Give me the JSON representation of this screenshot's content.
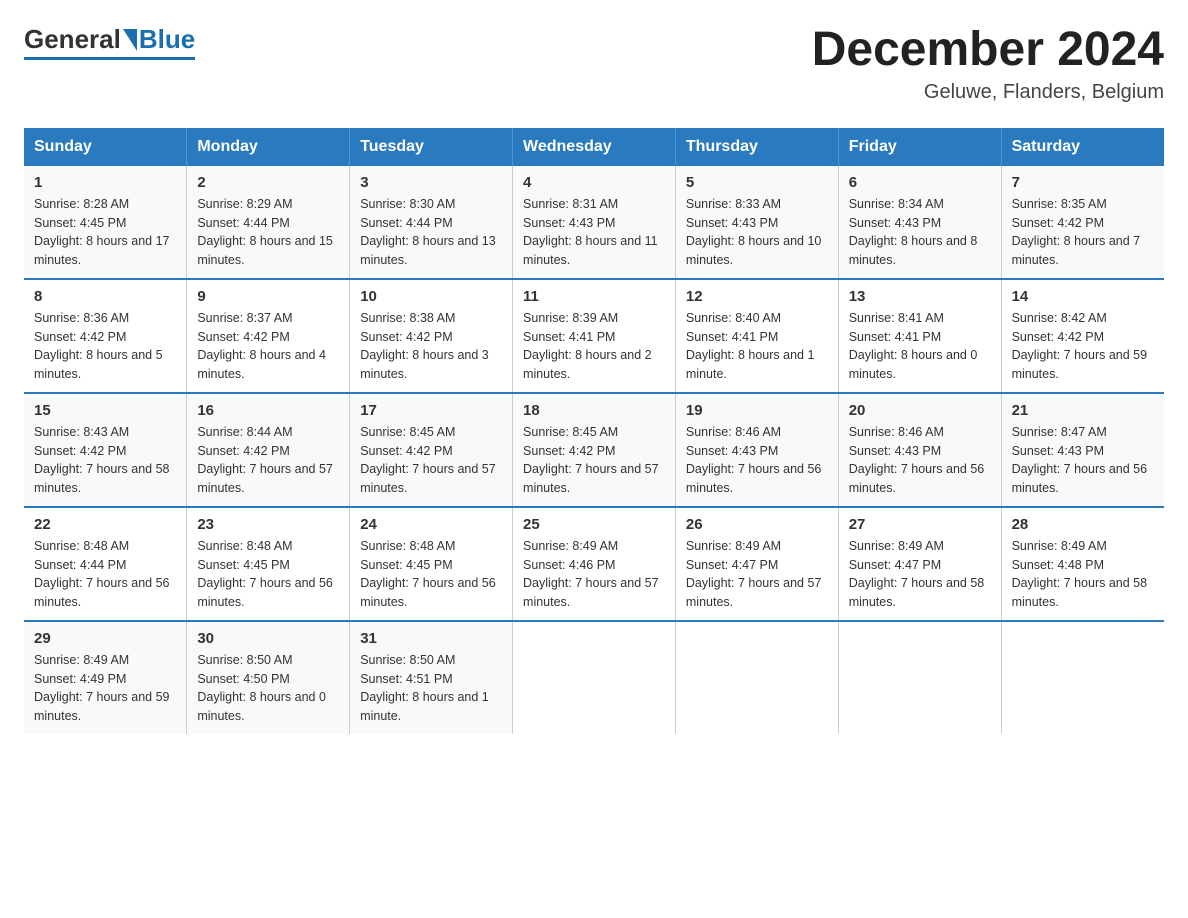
{
  "header": {
    "logo": {
      "general": "General",
      "blue": "Blue"
    },
    "title": "December 2024",
    "location": "Geluwe, Flanders, Belgium"
  },
  "days_of_week": [
    "Sunday",
    "Monday",
    "Tuesday",
    "Wednesday",
    "Thursday",
    "Friday",
    "Saturday"
  ],
  "weeks": [
    [
      {
        "day": "1",
        "sunrise": "8:28 AM",
        "sunset": "4:45 PM",
        "daylight": "8 hours and 17 minutes."
      },
      {
        "day": "2",
        "sunrise": "8:29 AM",
        "sunset": "4:44 PM",
        "daylight": "8 hours and 15 minutes."
      },
      {
        "day": "3",
        "sunrise": "8:30 AM",
        "sunset": "4:44 PM",
        "daylight": "8 hours and 13 minutes."
      },
      {
        "day": "4",
        "sunrise": "8:31 AM",
        "sunset": "4:43 PM",
        "daylight": "8 hours and 11 minutes."
      },
      {
        "day": "5",
        "sunrise": "8:33 AM",
        "sunset": "4:43 PM",
        "daylight": "8 hours and 10 minutes."
      },
      {
        "day": "6",
        "sunrise": "8:34 AM",
        "sunset": "4:43 PM",
        "daylight": "8 hours and 8 minutes."
      },
      {
        "day": "7",
        "sunrise": "8:35 AM",
        "sunset": "4:42 PM",
        "daylight": "8 hours and 7 minutes."
      }
    ],
    [
      {
        "day": "8",
        "sunrise": "8:36 AM",
        "sunset": "4:42 PM",
        "daylight": "8 hours and 5 minutes."
      },
      {
        "day": "9",
        "sunrise": "8:37 AM",
        "sunset": "4:42 PM",
        "daylight": "8 hours and 4 minutes."
      },
      {
        "day": "10",
        "sunrise": "8:38 AM",
        "sunset": "4:42 PM",
        "daylight": "8 hours and 3 minutes."
      },
      {
        "day": "11",
        "sunrise": "8:39 AM",
        "sunset": "4:41 PM",
        "daylight": "8 hours and 2 minutes."
      },
      {
        "day": "12",
        "sunrise": "8:40 AM",
        "sunset": "4:41 PM",
        "daylight": "8 hours and 1 minute."
      },
      {
        "day": "13",
        "sunrise": "8:41 AM",
        "sunset": "4:41 PM",
        "daylight": "8 hours and 0 minutes."
      },
      {
        "day": "14",
        "sunrise": "8:42 AM",
        "sunset": "4:42 PM",
        "daylight": "7 hours and 59 minutes."
      }
    ],
    [
      {
        "day": "15",
        "sunrise": "8:43 AM",
        "sunset": "4:42 PM",
        "daylight": "7 hours and 58 minutes."
      },
      {
        "day": "16",
        "sunrise": "8:44 AM",
        "sunset": "4:42 PM",
        "daylight": "7 hours and 57 minutes."
      },
      {
        "day": "17",
        "sunrise": "8:45 AM",
        "sunset": "4:42 PM",
        "daylight": "7 hours and 57 minutes."
      },
      {
        "day": "18",
        "sunrise": "8:45 AM",
        "sunset": "4:42 PM",
        "daylight": "7 hours and 57 minutes."
      },
      {
        "day": "19",
        "sunrise": "8:46 AM",
        "sunset": "4:43 PM",
        "daylight": "7 hours and 56 minutes."
      },
      {
        "day": "20",
        "sunrise": "8:46 AM",
        "sunset": "4:43 PM",
        "daylight": "7 hours and 56 minutes."
      },
      {
        "day": "21",
        "sunrise": "8:47 AM",
        "sunset": "4:43 PM",
        "daylight": "7 hours and 56 minutes."
      }
    ],
    [
      {
        "day": "22",
        "sunrise": "8:48 AM",
        "sunset": "4:44 PM",
        "daylight": "7 hours and 56 minutes."
      },
      {
        "day": "23",
        "sunrise": "8:48 AM",
        "sunset": "4:45 PM",
        "daylight": "7 hours and 56 minutes."
      },
      {
        "day": "24",
        "sunrise": "8:48 AM",
        "sunset": "4:45 PM",
        "daylight": "7 hours and 56 minutes."
      },
      {
        "day": "25",
        "sunrise": "8:49 AM",
        "sunset": "4:46 PM",
        "daylight": "7 hours and 57 minutes."
      },
      {
        "day": "26",
        "sunrise": "8:49 AM",
        "sunset": "4:47 PM",
        "daylight": "7 hours and 57 minutes."
      },
      {
        "day": "27",
        "sunrise": "8:49 AM",
        "sunset": "4:47 PM",
        "daylight": "7 hours and 58 minutes."
      },
      {
        "day": "28",
        "sunrise": "8:49 AM",
        "sunset": "4:48 PM",
        "daylight": "7 hours and 58 minutes."
      }
    ],
    [
      {
        "day": "29",
        "sunrise": "8:49 AM",
        "sunset": "4:49 PM",
        "daylight": "7 hours and 59 minutes."
      },
      {
        "day": "30",
        "sunrise": "8:50 AM",
        "sunset": "4:50 PM",
        "daylight": "8 hours and 0 minutes."
      },
      {
        "day": "31",
        "sunrise": "8:50 AM",
        "sunset": "4:51 PM",
        "daylight": "8 hours and 1 minute."
      },
      null,
      null,
      null,
      null
    ]
  ],
  "labels": {
    "sunrise": "Sunrise:",
    "sunset": "Sunset:",
    "daylight": "Daylight:"
  }
}
